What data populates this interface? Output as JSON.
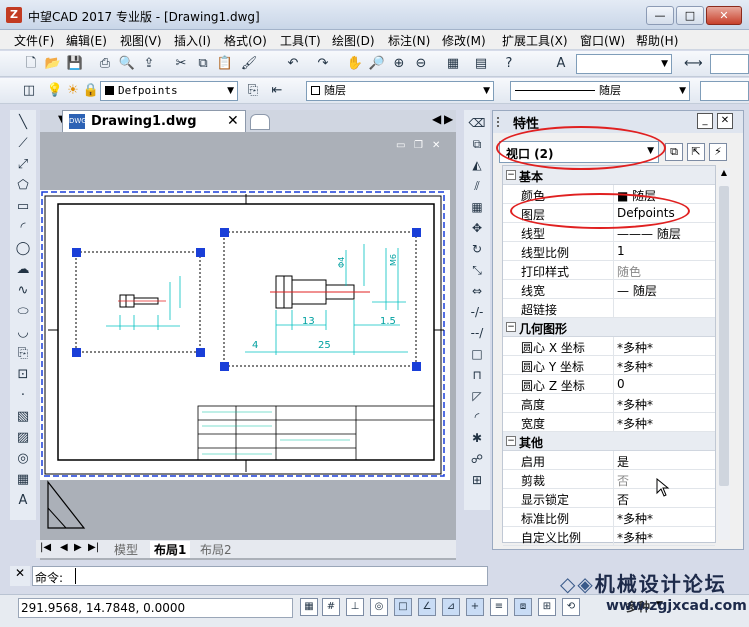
{
  "window": {
    "title": "中望CAD 2017 专业版 - [Drawing1.dwg]",
    "icon": "zwcad-app-icon"
  },
  "menu": [
    "文件(F)",
    "编辑(E)",
    "视图(V)",
    "插入(I)",
    "格式(O)",
    "工具(T)",
    "绘图(D)",
    "标注(N)",
    "修改(M)",
    "扩展工具(X)",
    "窗口(W)",
    "帮助(H)"
  ],
  "layer_toolbar": {
    "layer_name": "Defpoints",
    "bylayer1": "随层",
    "bylayer2": "随层"
  },
  "doc_tab": {
    "name": "Drawing1.dwg"
  },
  "layout_tabs": [
    "模型",
    "布局1",
    "布局2"
  ],
  "properties": {
    "title": "特性",
    "selection": "视口 (2)",
    "categories": [
      {
        "name": "基本",
        "rows": [
          [
            "颜色",
            "■ 随层"
          ],
          [
            "图层",
            "Defpoints"
          ],
          [
            "线型",
            "——— 随层"
          ],
          [
            "线型比例",
            "1"
          ],
          [
            "打印样式",
            "随色"
          ],
          [
            "线宽",
            "— 随层"
          ],
          [
            "超链接",
            ""
          ]
        ]
      },
      {
        "name": "几何图形",
        "rows": [
          [
            "圆心 X 坐标",
            "*多种*"
          ],
          [
            "圆心 Y 坐标",
            "*多种*"
          ],
          [
            "圆心 Z 坐标",
            "0"
          ],
          [
            "高度",
            "*多种*"
          ],
          [
            "宽度",
            "*多种*"
          ]
        ]
      },
      {
        "name": "其他",
        "rows": [
          [
            "启用",
            "是"
          ],
          [
            "剪裁",
            "否"
          ],
          [
            "显示锁定",
            "否"
          ],
          [
            "标准比例",
            "*多种*"
          ],
          [
            "自定义比例",
            "*多种*"
          ]
        ]
      }
    ]
  },
  "command": {
    "prompt": "命令:",
    "value": ""
  },
  "status": {
    "coordinates": "291.9568, 14.7848, 0.0000",
    "annotation": "多种"
  },
  "watermark": {
    "text": "机械设计论坛",
    "url": "www.zgjxcad.com"
  },
  "drawing_dims": [
    "13",
    "1.5",
    "4",
    "25",
    "Φ4",
    "M6"
  ],
  "colors": {
    "accent": "#1a3fd8",
    "highlight": "#e02020",
    "dims": "#00a0a0"
  }
}
